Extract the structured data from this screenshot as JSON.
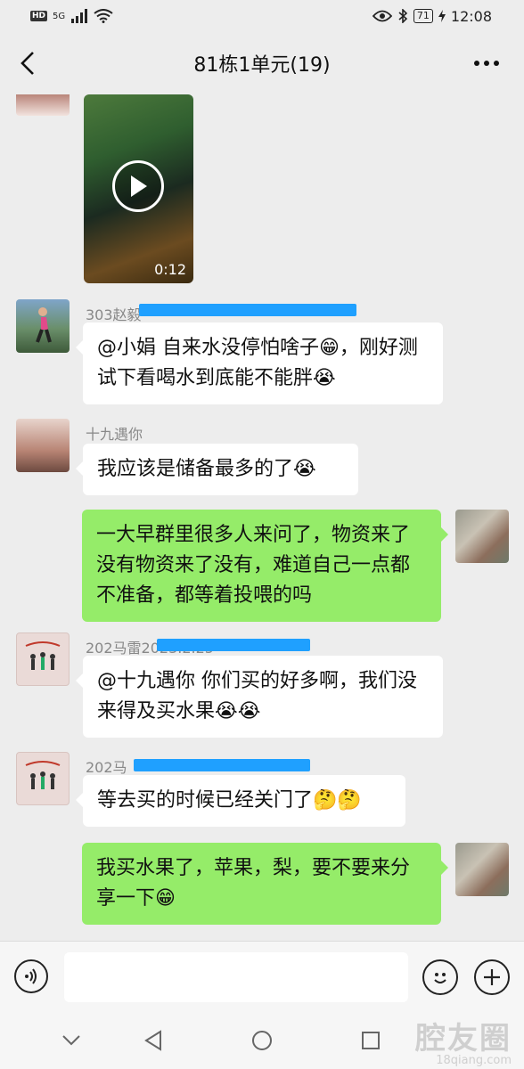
{
  "status_bar": {
    "hd": "HD",
    "signal": "5G",
    "battery": "71",
    "time": "12:08"
  },
  "header": {
    "title": "81栋1单元(19)"
  },
  "video": {
    "duration": "0:12"
  },
  "messages": [
    {
      "sender": "303赵毅",
      "text": "@小娟 自来水没停怕啥子😁，刚好测试下看喝水到底能不能胖😭"
    },
    {
      "sender": "十九遇你",
      "text": "我应该是储备最多的了😭"
    },
    {
      "text": "一大早群里很多人来问了，物资来了没有物资来了没有，难道自己一点都不准备，都等着投喂的吗"
    },
    {
      "sender": "202马雷2023.2.25",
      "text": "@十九遇你 你们买的好多啊，我们没来得及买水果😭😭"
    },
    {
      "sender": "202马",
      "text": "等去买的时候已经关门了🤔🤔"
    },
    {
      "text": "我买水果了，苹果，梨，要不要来分享一下😁"
    }
  ],
  "input": {
    "value": "",
    "placeholder": ""
  },
  "watermark": {
    "main": "腔友圈",
    "sub": "18qiang.com"
  },
  "colors": {
    "background": "#ededed",
    "bubble_in": "#ffffff",
    "bubble_out": "#95ec69",
    "redaction": "#1fa0ff"
  }
}
